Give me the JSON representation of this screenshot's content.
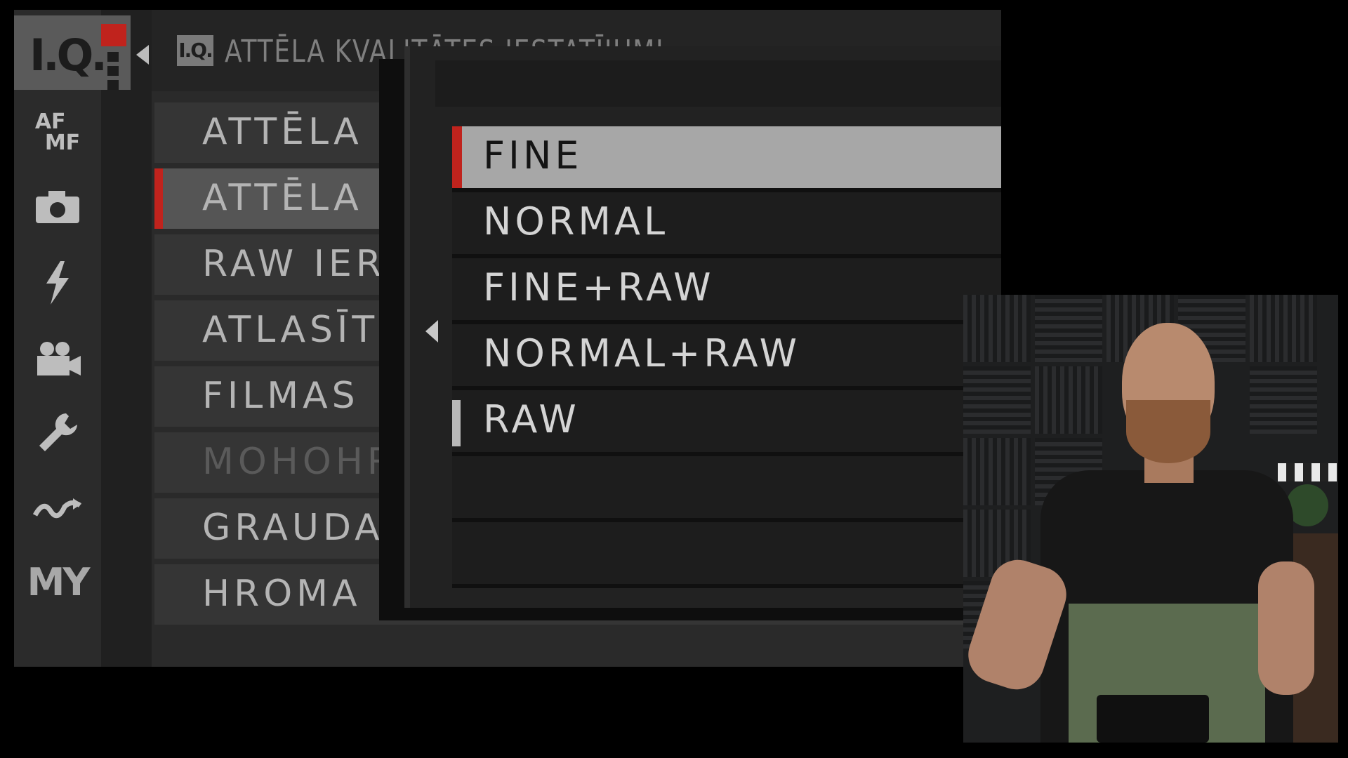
{
  "header": {
    "tab_badge": "I.Q.",
    "header_badge": "I.Q.",
    "title": "ATTĒLA KVALITĀTES IESTATĪJUMI"
  },
  "sidebar": {
    "icons": [
      "image-quality-icon",
      "af-mf-icon",
      "camera-icon",
      "flash-icon",
      "movie-camera-icon",
      "wrench-icon",
      "connection-icon",
      "my-menu-icon"
    ],
    "af_mf_top": "AF",
    "af_mf_bottom": "MF",
    "my_label": "MY"
  },
  "menu": {
    "items": [
      {
        "label": "ATTĒLA"
      },
      {
        "label": "ATTĒLA"
      },
      {
        "label": "RAW IER"
      },
      {
        "label": "ATLASĪT"
      },
      {
        "label": "FILMAS"
      },
      {
        "label": "MOHOHR"
      },
      {
        "label": "GRAUDAI"
      },
      {
        "label": "HROMA K"
      }
    ]
  },
  "popup": {
    "options": [
      {
        "label": "FINE"
      },
      {
        "label": "NORMAL"
      },
      {
        "label": "FINE+RAW"
      },
      {
        "label": "NORMAL+RAW"
      },
      {
        "label": "RAW"
      }
    ],
    "selected": "FINE",
    "current": "RAW"
  },
  "colors": {
    "accent_red": "#c0231d",
    "highlight": "#a7a7a7"
  }
}
